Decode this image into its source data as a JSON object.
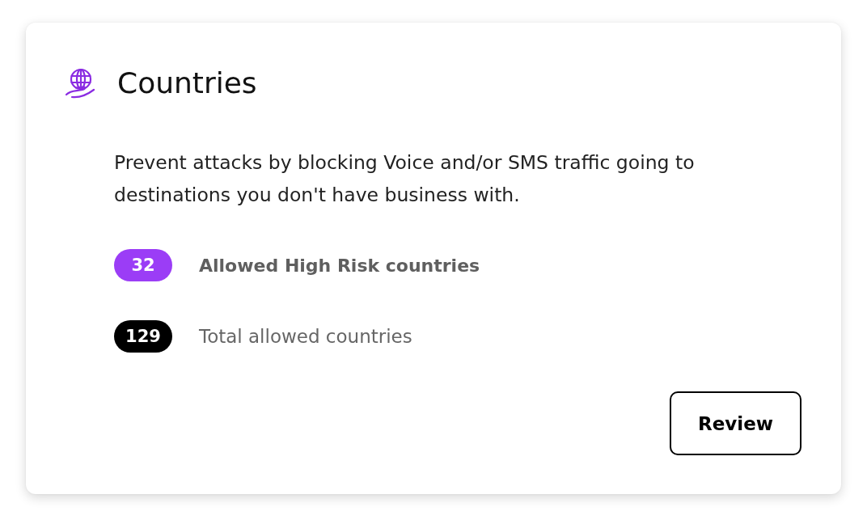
{
  "card": {
    "title": "Countries",
    "description": "Prevent attacks by blocking Voice and/or SMS traffic going to destinations you don't have business with.",
    "stats": [
      {
        "count": "32",
        "label": "Allowed High Risk countries",
        "color": "#9b3df6",
        "emphasized": true
      },
      {
        "count": "129",
        "label": "Total allowed countries",
        "color": "#000000",
        "emphasized": false
      }
    ],
    "button": {
      "label": "Review"
    }
  }
}
